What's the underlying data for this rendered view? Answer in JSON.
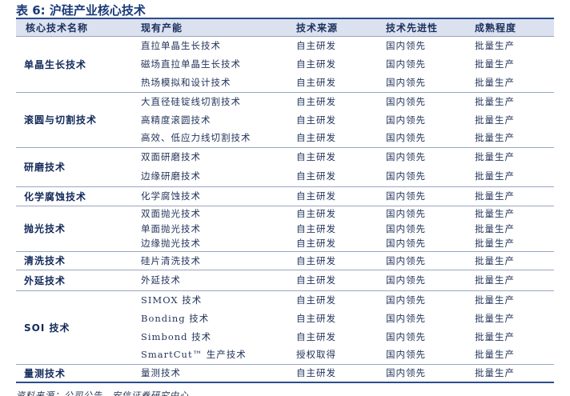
{
  "title": "表 6:  沪硅产业核心技术",
  "columns": [
    "核心技术名称",
    "现有产能",
    "技术来源",
    "技术先进性",
    "成熟程度"
  ],
  "groups": [
    {
      "name": "单晶生长技术",
      "rows": [
        [
          "直拉单晶生长技术",
          "自主研发",
          "国内领先",
          "批量生产"
        ],
        [
          "磁场直拉单晶生长技术",
          "自主研发",
          "国内领先",
          "批量生产"
        ],
        [
          "热场模拟和设计技术",
          "自主研发",
          "国内领先",
          "批量生产"
        ]
      ]
    },
    {
      "name": "滚圆与切割技术",
      "rows": [
        [
          "大直径硅锭线切割技术",
          "自主研发",
          "国内领先",
          "批量生产"
        ],
        [
          "高精度滚圆技术",
          "自主研发",
          "国内领先",
          "批量生产"
        ],
        [
          "高效、低应力线切割技术",
          "自主研发",
          "国内领先",
          "批量生产"
        ]
      ]
    },
    {
      "name": "研磨技术",
      "rows": [
        [
          "双面研磨技术",
          "自主研发",
          "国内领先",
          "批量生产"
        ],
        [
          "边缘研磨技术",
          "自主研发",
          "国内领先",
          "批量生产"
        ]
      ]
    },
    {
      "name": "化学腐蚀技术",
      "rows": [
        [
          "化学腐蚀技术",
          "自主研发",
          "国内领先",
          "批量生产"
        ]
      ]
    },
    {
      "name": "抛光技术",
      "rows": [
        [
          "双面抛光技术",
          "自主研发",
          "国内领先",
          "批量生产"
        ],
        [
          "单面抛光技术",
          "自主研发",
          "国内领先",
          "批量生产"
        ],
        [
          "边缘抛光技术",
          "自主研发",
          "国内领先",
          "批量生产"
        ]
      ]
    },
    {
      "name": "清洗技术",
      "rows": [
        [
          "硅片清洗技术",
          "自主研发",
          "国内领先",
          "批量生产"
        ]
      ]
    },
    {
      "name": "外延技术",
      "rows": [
        [
          "外延技术",
          "自主研发",
          "国内领先",
          "批量生产"
        ]
      ]
    },
    {
      "name": "SOI 技术",
      "rows": [
        [
          "SIMOX 技术",
          "自主研发",
          "国内领先",
          "批量生产"
        ],
        [
          "Bonding 技术",
          "自主研发",
          "国内领先",
          "批量生产"
        ],
        [
          "Simbond 技术",
          "自主研发",
          "国内领先",
          "批量生产"
        ],
        [
          "SmartCut™ 生产技术",
          "授权取得",
          "国内领先",
          "批量生产"
        ]
      ]
    },
    {
      "name": "量测技术",
      "rows": [
        [
          "量测技术",
          "自主研发",
          "国内领先",
          "批量生产"
        ]
      ]
    }
  ],
  "source": "资料来源：公司公告，安信证券研究中心"
}
